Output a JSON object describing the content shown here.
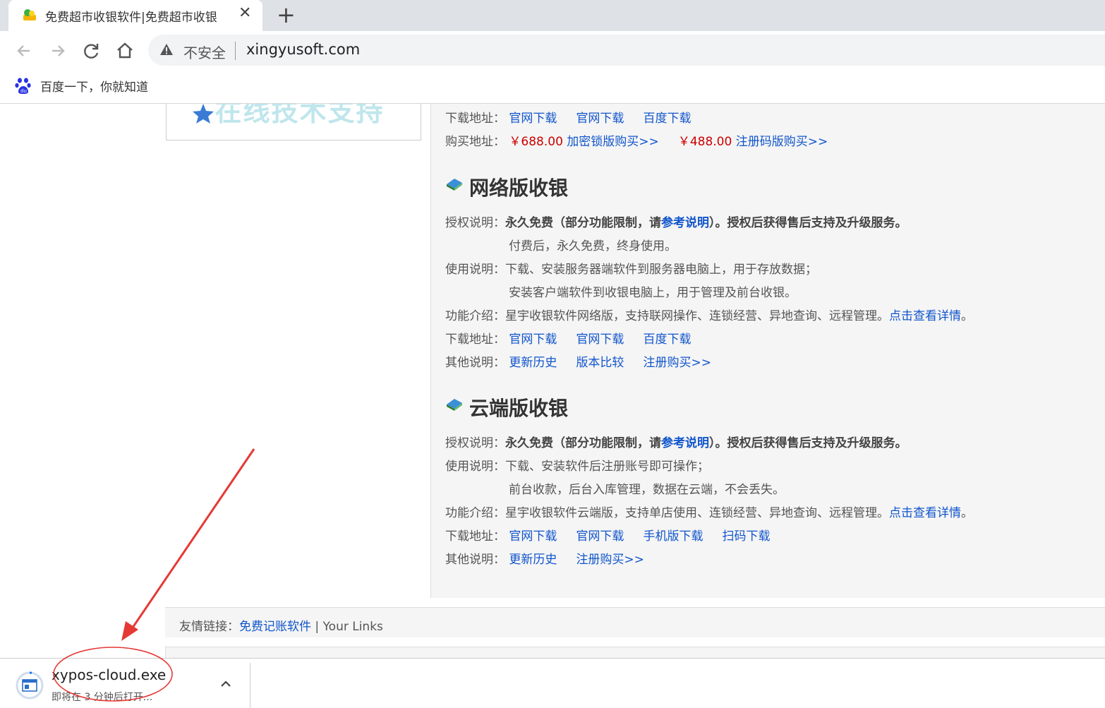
{
  "browser": {
    "tab": {
      "title": "免费超市收银软件|免费超市收银",
      "close": "✕"
    },
    "new_tab": "+",
    "security_label": "不安全",
    "url": "xingyusoft.com",
    "bookmark": "百度一下，你就知道"
  },
  "top_section": {
    "download_label": "下载地址：",
    "download_links": [
      "官网下载",
      "官网下载",
      "百度下载"
    ],
    "buy_label": "购买地址：",
    "buy_price1": "￥688.00",
    "buy_link1": "加密锁版购买>>",
    "buy_price2": "￥488.00",
    "buy_link2": "注册码版购买>>"
  },
  "network": {
    "title": "网络版收银",
    "license_label": "授权说明：",
    "license_text1": "永久免费（部分功能限制，请",
    "license_link": "参考说明",
    "license_text2": "）。授权后获得售后支持及升级服务。",
    "license_line2": "付费后，永久免费，终身使用。",
    "usage_label": "使用说明：",
    "usage_line1": "下载、安装服务器端软件到服务器电脑上，用于存放数据；",
    "usage_line2": "安装客户端软件到收银电脑上，用于管理及前台收银。",
    "feature_label": "功能介绍：",
    "feature_text": "星宇收银软件网络版，支持联网操作、连锁经营、异地查询、远程管理。",
    "feature_link": "点击查看详情",
    "feature_end": "。",
    "download_label": "下载地址：",
    "download_links": [
      "官网下载",
      "官网下载",
      "百度下载"
    ],
    "other_label": "其他说明：",
    "other_links": [
      "更新历史",
      "版本比较",
      "注册购买>>"
    ]
  },
  "cloud": {
    "title": "云端版收银",
    "license_label": "授权说明：",
    "license_text1": "永久免费（部分功能限制，请",
    "license_link": "参考说明",
    "license_text2": "）。授权后获得售后支持及升级服务。",
    "usage_label": "使用说明：",
    "usage_line1": "下载、安装软件后注册账号即可操作；",
    "usage_line2": "前台收款，后台入库管理，数据在云端，不会丢失。",
    "feature_label": "功能介绍：",
    "feature_text": "星宇收银软件云端版，支持单店使用、连锁经营、异地查询、远程管理。",
    "feature_link": "点击查看详情",
    "feature_end": "。",
    "download_label": "下载地址：",
    "download_links": [
      "官网下载",
      "官网下载",
      "手机版下载",
      "扫码下载"
    ],
    "other_label": "其他说明：",
    "other_links": [
      "更新历史",
      "注册购买>>"
    ]
  },
  "friend_links": {
    "label": "友情链接：",
    "link": "免费记账软件",
    "sep": " | ",
    "extra": "Your Links"
  },
  "download_shelf": {
    "filename": "xypos-cloud.exe",
    "status": "即将在 3 分钟后打开..."
  },
  "colors": {
    "link": "#1155cc",
    "price": "#cc0000",
    "annotation": "#e53935"
  }
}
